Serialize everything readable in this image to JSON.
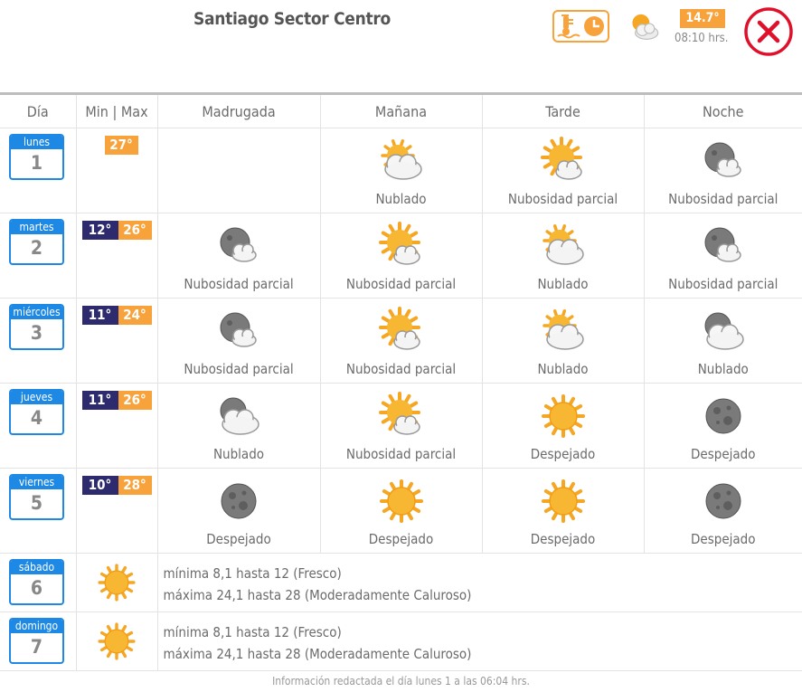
{
  "header": {
    "title": "Santiago Sector Centro",
    "current_temp": "14.7°",
    "time": "08:10 hrs.",
    "current_condition": "partly-cloudy-day-icon"
  },
  "table": {
    "headers": [
      "Día",
      "Min | Max",
      "Madrugada",
      "Mañana",
      "Tarde",
      "Noche"
    ],
    "days": [
      {
        "name": "lunes",
        "num": "1",
        "min": "",
        "max": "27°",
        "cells": [
          null,
          {
            "icon": "cloudy-day",
            "label": "Nublado"
          },
          {
            "icon": "partly-day",
            "label": "Nubosidad parcial"
          },
          {
            "icon": "partly-night",
            "label": "Nubosidad parcial"
          }
        ]
      },
      {
        "name": "martes",
        "num": "2",
        "min": "12°",
        "max": "26°",
        "cells": [
          {
            "icon": "partly-night",
            "label": "Nubosidad parcial"
          },
          {
            "icon": "partly-day",
            "label": "Nubosidad parcial"
          },
          {
            "icon": "cloudy-day",
            "label": "Nublado"
          },
          {
            "icon": "partly-night",
            "label": "Nubosidad parcial"
          }
        ]
      },
      {
        "name": "miércoles",
        "num": "3",
        "min": "11°",
        "max": "24°",
        "cells": [
          {
            "icon": "partly-night",
            "label": "Nubosidad parcial"
          },
          {
            "icon": "partly-day",
            "label": "Nubosidad parcial"
          },
          {
            "icon": "cloudy-day",
            "label": "Nublado"
          },
          {
            "icon": "cloudy-night",
            "label": "Nublado"
          }
        ]
      },
      {
        "name": "jueves",
        "num": "4",
        "min": "11°",
        "max": "26°",
        "cells": [
          {
            "icon": "cloudy-night",
            "label": "Nublado"
          },
          {
            "icon": "partly-day",
            "label": "Nubosidad parcial"
          },
          {
            "icon": "sun",
            "label": "Despejado"
          },
          {
            "icon": "moon",
            "label": "Despejado"
          }
        ]
      },
      {
        "name": "viernes",
        "num": "5",
        "min": "10°",
        "max": "28°",
        "cells": [
          {
            "icon": "moon",
            "label": "Despejado"
          },
          {
            "icon": "sun",
            "label": "Despejado"
          },
          {
            "icon": "sun",
            "label": "Despejado"
          },
          {
            "icon": "moon",
            "label": "Despejado"
          }
        ]
      }
    ],
    "summary_days": [
      {
        "name": "sábado",
        "num": "6",
        "icon": "sun",
        "line1": "mínima 8,1 hasta 12 (Fresco)",
        "line2": "máxima 24,1 hasta 28 (Moderadamente Caluroso)"
      },
      {
        "name": "domingo",
        "num": "7",
        "icon": "sun",
        "line1": "mínima 8,1 hasta 12 (Fresco)",
        "line2": "máxima 24,1 hasta 28 (Moderadamente Caluroso)"
      }
    ]
  },
  "footer": "Información redactada el día lunes 1 a las 06:04 hrs.",
  "colors": {
    "accent_orange": "#f7a23b",
    "day_blue": "#1e88e5",
    "min_navy": "#2d2a6e",
    "close_red": "#e0102a"
  }
}
